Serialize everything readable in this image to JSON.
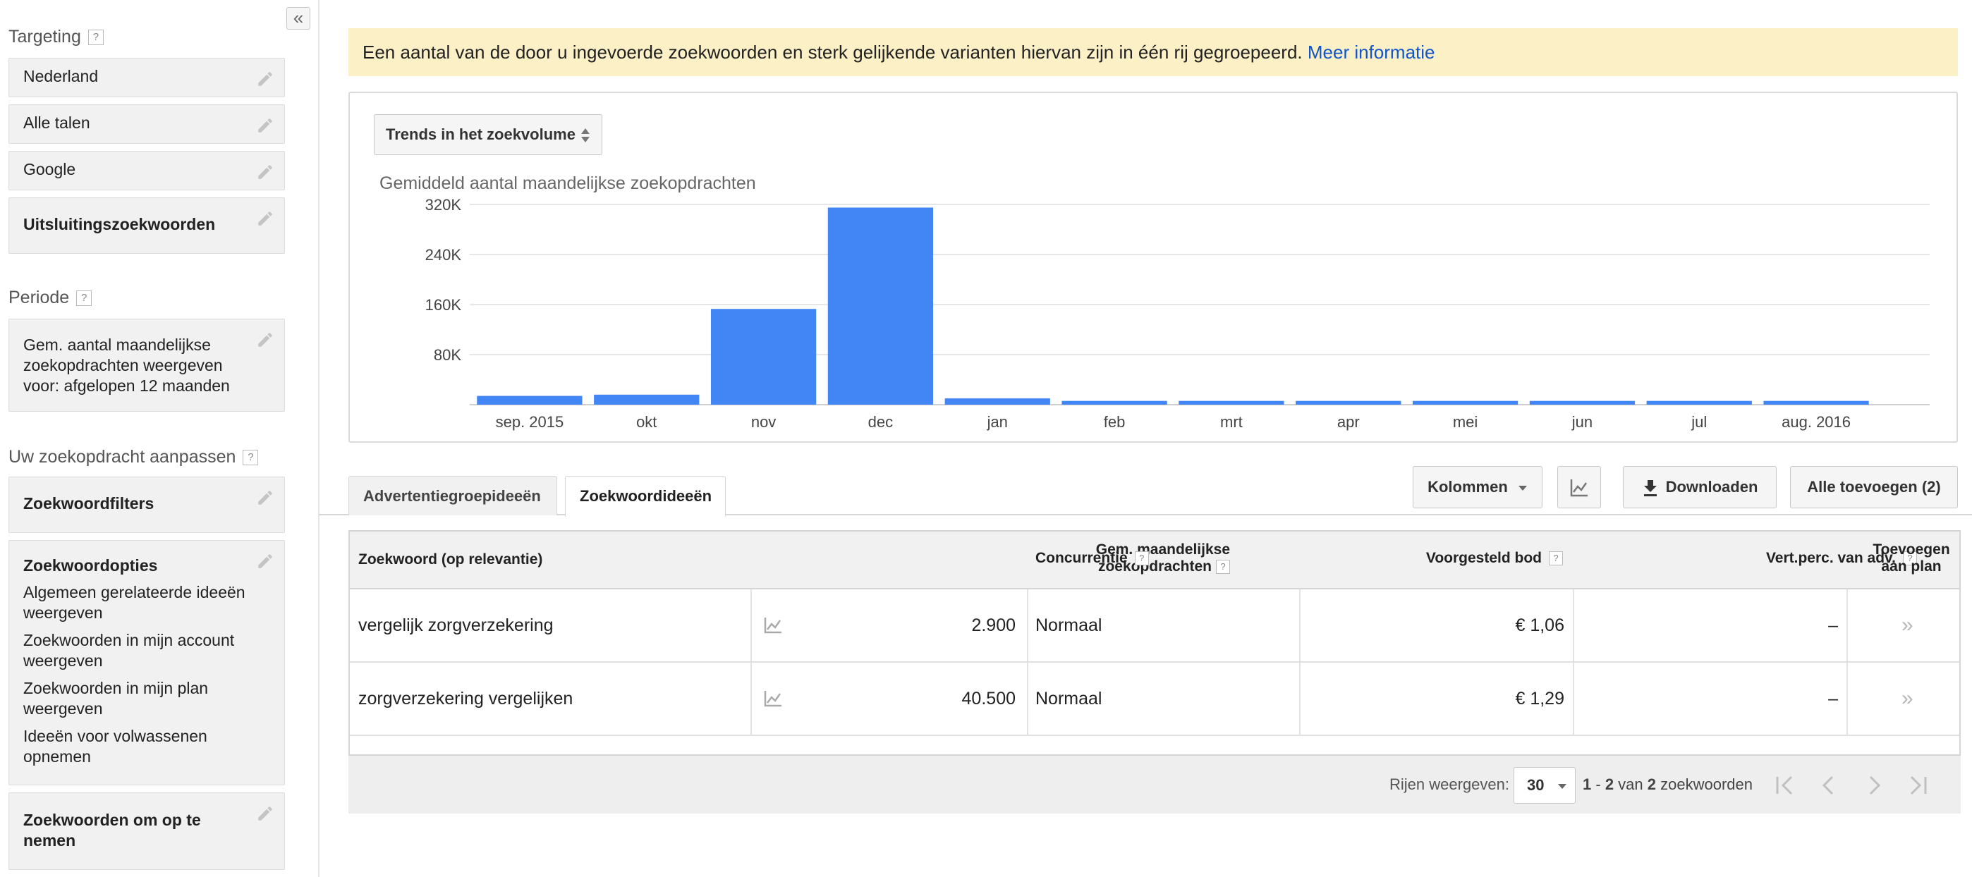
{
  "sidebar": {
    "collapse": "«",
    "targeting": {
      "heading": "Targeting",
      "help": "?",
      "items": [
        "Nederland",
        "Alle talen",
        "Google",
        "Uitsluitingszoekwoorden"
      ]
    },
    "period": {
      "heading": "Periode",
      "help": "?",
      "value": "Gem. aantal maandelijkse zoekopdrachten weergeven voor: afgelopen 12 maanden"
    },
    "customize": {
      "heading": "Uw zoekopdracht aanpassen",
      "help": "?",
      "filters": "Zoekwoordfilters",
      "options_title": "Zoekwoordopties",
      "options": [
        "Algemeen gerelateerde ideeën weergeven",
        "Zoekwoorden in mijn account weergeven",
        "Zoekwoorden in mijn plan weergeven",
        "Ideeën voor volwassenen opnemen"
      ],
      "include": "Zoekwoorden om op te nemen"
    }
  },
  "notice": {
    "text": "Een aantal van de door u ingevoerde zoekwoorden en sterk gelijkende varianten hiervan zijn in één rij gegroepeerd.",
    "link": "Meer informatie"
  },
  "chart_panel": {
    "selector": "Trends in het zoekvolume"
  },
  "chart_data": {
    "type": "bar",
    "title": "Gemiddeld aantal maandelijkse zoekopdrachten",
    "categories": [
      "sep. 2015",
      "okt",
      "nov",
      "dec",
      "jan",
      "feb",
      "mrt",
      "apr",
      "mei",
      "jun",
      "jul",
      "aug. 2016"
    ],
    "values": [
      14000,
      16000,
      153000,
      315000,
      10000,
      6000,
      6000,
      6000,
      6000,
      6000,
      6000,
      6000
    ],
    "ylim": [
      0,
      320000
    ],
    "yticks": [
      80000,
      160000,
      240000,
      320000
    ],
    "ytick_labels": [
      "80K",
      "160K",
      "240K",
      "320K"
    ],
    "grid": true,
    "colors": {
      "bar": "#4285f4",
      "grid": "#e6e6e6",
      "axis": "#d0d0d0"
    }
  },
  "tabs": [
    {
      "label": "Advertentiegroepideeën",
      "active": false
    },
    {
      "label": "Zoekwoordideeën",
      "active": true
    }
  ],
  "toolbar": {
    "columns": "Kolommen",
    "download": "Downloaden",
    "add_all": "Alle toevoegen (2)"
  },
  "table": {
    "headers": {
      "keyword": "Zoekwoord (op relevantie)",
      "avg_searches_line1": "Gem. maandelijkse",
      "avg_searches_line2": "zoekopdrachten",
      "competition": "Concurrentie",
      "suggested_bid": "Voorgesteld bod",
      "ad_share": "Vert.perc. van adv.",
      "add_line1": "Toevoegen",
      "add_line2": "aan plan",
      "help": "?"
    },
    "rows": [
      {
        "keyword": "vergelijk zorgverzekering",
        "searches": "2.900",
        "competition": "Normaal",
        "bid": "€ 1,06",
        "share": "–",
        "add": "»"
      },
      {
        "keyword": "zorgverzekering vergelijken",
        "searches": "40.500",
        "competition": "Normaal",
        "bid": "€ 1,29",
        "share": "–",
        "add": "»"
      }
    ]
  },
  "pagination": {
    "rows_label": "Rijen weergeven:",
    "rows_value": "30",
    "range_start": "1",
    "range_sep": " - ",
    "range_end": "2",
    "range_of": " van ",
    "total": "2",
    "range_suffix": " zoekwoorden"
  }
}
